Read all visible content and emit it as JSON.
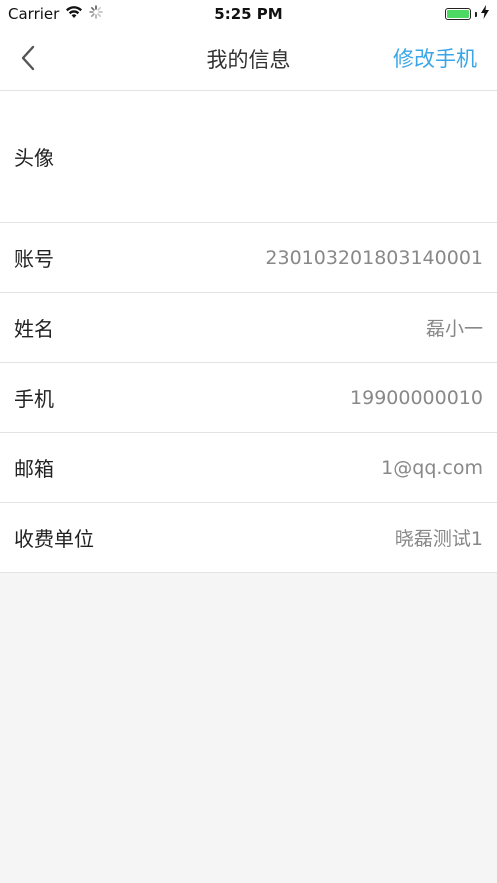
{
  "status_bar": {
    "carrier": "Carrier",
    "time": "5:25 PM",
    "battery_level": 1.0,
    "icons": [
      "wifi-icon",
      "activity-spinner-icon",
      "battery-icon",
      "charging-bolt-icon"
    ]
  },
  "nav": {
    "back_icon": "chevron-left-icon",
    "title": "我的信息",
    "action_label": "修改手机",
    "accent_color": "#3aa6e8"
  },
  "profile": {
    "avatar_label": "头像",
    "rows": [
      {
        "label": "账号",
        "value": "230103201803140001"
      },
      {
        "label": "姓名",
        "value": "磊小一"
      },
      {
        "label": "手机",
        "value": "19900000010"
      },
      {
        "label": "邮箱",
        "value": "1@qq.com"
      },
      {
        "label": "收费单位",
        "value": "晓磊测试1"
      }
    ]
  }
}
